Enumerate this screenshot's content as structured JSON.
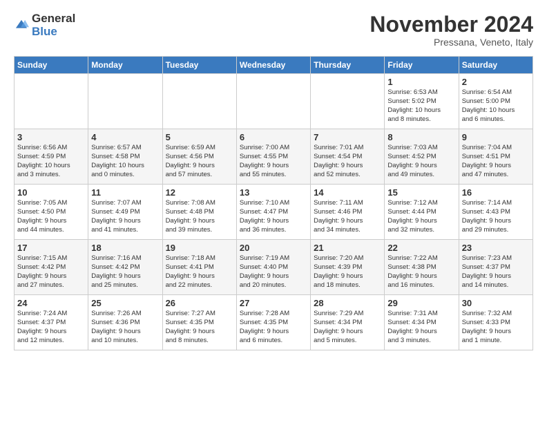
{
  "logo": {
    "general": "General",
    "blue": "Blue"
  },
  "title": "November 2024",
  "subtitle": "Pressana, Veneto, Italy",
  "headers": [
    "Sunday",
    "Monday",
    "Tuesday",
    "Wednesday",
    "Thursday",
    "Friday",
    "Saturday"
  ],
  "weeks": [
    [
      {
        "day": "",
        "info": ""
      },
      {
        "day": "",
        "info": ""
      },
      {
        "day": "",
        "info": ""
      },
      {
        "day": "",
        "info": ""
      },
      {
        "day": "",
        "info": ""
      },
      {
        "day": "1",
        "info": "Sunrise: 6:53 AM\nSunset: 5:02 PM\nDaylight: 10 hours\nand 8 minutes."
      },
      {
        "day": "2",
        "info": "Sunrise: 6:54 AM\nSunset: 5:00 PM\nDaylight: 10 hours\nand 6 minutes."
      }
    ],
    [
      {
        "day": "3",
        "info": "Sunrise: 6:56 AM\nSunset: 4:59 PM\nDaylight: 10 hours\nand 3 minutes."
      },
      {
        "day": "4",
        "info": "Sunrise: 6:57 AM\nSunset: 4:58 PM\nDaylight: 10 hours\nand 0 minutes."
      },
      {
        "day": "5",
        "info": "Sunrise: 6:59 AM\nSunset: 4:56 PM\nDaylight: 9 hours\nand 57 minutes."
      },
      {
        "day": "6",
        "info": "Sunrise: 7:00 AM\nSunset: 4:55 PM\nDaylight: 9 hours\nand 55 minutes."
      },
      {
        "day": "7",
        "info": "Sunrise: 7:01 AM\nSunset: 4:54 PM\nDaylight: 9 hours\nand 52 minutes."
      },
      {
        "day": "8",
        "info": "Sunrise: 7:03 AM\nSunset: 4:52 PM\nDaylight: 9 hours\nand 49 minutes."
      },
      {
        "day": "9",
        "info": "Sunrise: 7:04 AM\nSunset: 4:51 PM\nDaylight: 9 hours\nand 47 minutes."
      }
    ],
    [
      {
        "day": "10",
        "info": "Sunrise: 7:05 AM\nSunset: 4:50 PM\nDaylight: 9 hours\nand 44 minutes."
      },
      {
        "day": "11",
        "info": "Sunrise: 7:07 AM\nSunset: 4:49 PM\nDaylight: 9 hours\nand 41 minutes."
      },
      {
        "day": "12",
        "info": "Sunrise: 7:08 AM\nSunset: 4:48 PM\nDaylight: 9 hours\nand 39 minutes."
      },
      {
        "day": "13",
        "info": "Sunrise: 7:10 AM\nSunset: 4:47 PM\nDaylight: 9 hours\nand 36 minutes."
      },
      {
        "day": "14",
        "info": "Sunrise: 7:11 AM\nSunset: 4:46 PM\nDaylight: 9 hours\nand 34 minutes."
      },
      {
        "day": "15",
        "info": "Sunrise: 7:12 AM\nSunset: 4:44 PM\nDaylight: 9 hours\nand 32 minutes."
      },
      {
        "day": "16",
        "info": "Sunrise: 7:14 AM\nSunset: 4:43 PM\nDaylight: 9 hours\nand 29 minutes."
      }
    ],
    [
      {
        "day": "17",
        "info": "Sunrise: 7:15 AM\nSunset: 4:42 PM\nDaylight: 9 hours\nand 27 minutes."
      },
      {
        "day": "18",
        "info": "Sunrise: 7:16 AM\nSunset: 4:42 PM\nDaylight: 9 hours\nand 25 minutes."
      },
      {
        "day": "19",
        "info": "Sunrise: 7:18 AM\nSunset: 4:41 PM\nDaylight: 9 hours\nand 22 minutes."
      },
      {
        "day": "20",
        "info": "Sunrise: 7:19 AM\nSunset: 4:40 PM\nDaylight: 9 hours\nand 20 minutes."
      },
      {
        "day": "21",
        "info": "Sunrise: 7:20 AM\nSunset: 4:39 PM\nDaylight: 9 hours\nand 18 minutes."
      },
      {
        "day": "22",
        "info": "Sunrise: 7:22 AM\nSunset: 4:38 PM\nDaylight: 9 hours\nand 16 minutes."
      },
      {
        "day": "23",
        "info": "Sunrise: 7:23 AM\nSunset: 4:37 PM\nDaylight: 9 hours\nand 14 minutes."
      }
    ],
    [
      {
        "day": "24",
        "info": "Sunrise: 7:24 AM\nSunset: 4:37 PM\nDaylight: 9 hours\nand 12 minutes."
      },
      {
        "day": "25",
        "info": "Sunrise: 7:26 AM\nSunset: 4:36 PM\nDaylight: 9 hours\nand 10 minutes."
      },
      {
        "day": "26",
        "info": "Sunrise: 7:27 AM\nSunset: 4:35 PM\nDaylight: 9 hours\nand 8 minutes."
      },
      {
        "day": "27",
        "info": "Sunrise: 7:28 AM\nSunset: 4:35 PM\nDaylight: 9 hours\nand 6 minutes."
      },
      {
        "day": "28",
        "info": "Sunrise: 7:29 AM\nSunset: 4:34 PM\nDaylight: 9 hours\nand 5 minutes."
      },
      {
        "day": "29",
        "info": "Sunrise: 7:31 AM\nSunset: 4:34 PM\nDaylight: 9 hours\nand 3 minutes."
      },
      {
        "day": "30",
        "info": "Sunrise: 7:32 AM\nSunset: 4:33 PM\nDaylight: 9 hours\nand 1 minute."
      }
    ]
  ]
}
